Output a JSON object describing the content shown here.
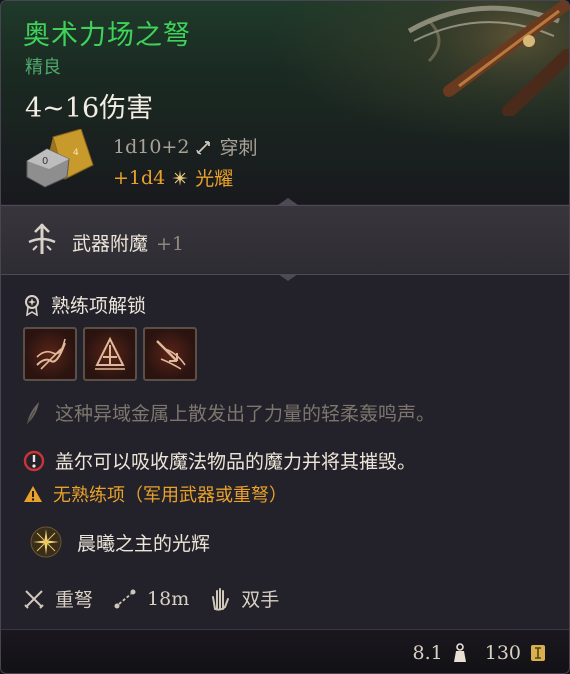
{
  "item": {
    "name": "奥术力场之弩",
    "rarity": "精良",
    "damage_range": "4~16伤害",
    "damage_lines": [
      {
        "dice": "1d10+2",
        "type": "穿刺",
        "color": "#a9a297",
        "icon": "arrow-pierce-icon"
      },
      {
        "dice": "+1d4",
        "type": "光耀",
        "color": "#e8a12a",
        "icon": "radiant-star-icon"
      }
    ]
  },
  "enchantment": {
    "label": "武器附魔",
    "bonus": "+1",
    "icon": "weapon-enchant-icon"
  },
  "proficiency": {
    "heading": "熟练项解锁",
    "icon": "proficiency-medal-icon",
    "skills": [
      {
        "name": "skill-slot-1",
        "icon": "piercing-shot-icon"
      },
      {
        "name": "skill-slot-2",
        "icon": "brace-icon"
      },
      {
        "name": "skill-slot-3",
        "icon": "hamstring-shot-icon"
      }
    ]
  },
  "description": "这种异域金属上散发出了力量的轻柔轰鸣声。",
  "notes": {
    "special": "盖尔可以吸收魔法物品的魔力并将其摧毁。",
    "warning": "无熟练项（军用武器或重弩）"
  },
  "passive": {
    "label": "晨曦之主的光辉",
    "icon": "dawnmaster-radiance-icon"
  },
  "properties": [
    {
      "label": "重弩",
      "icon": "crossed-swords-icon"
    },
    {
      "label": "18m",
      "icon": "range-icon"
    },
    {
      "label": "双手",
      "icon": "two-handed-icon"
    }
  ],
  "footer": {
    "weight": "8.1",
    "value": "130",
    "weight_icon": "weight-icon",
    "value_icon": "gold-coin-icon"
  },
  "colors": {
    "title": "#3ed25a",
    "rarity": "#4ea86a",
    "radiant": "#e8a12a",
    "muted": "#7c766e"
  }
}
